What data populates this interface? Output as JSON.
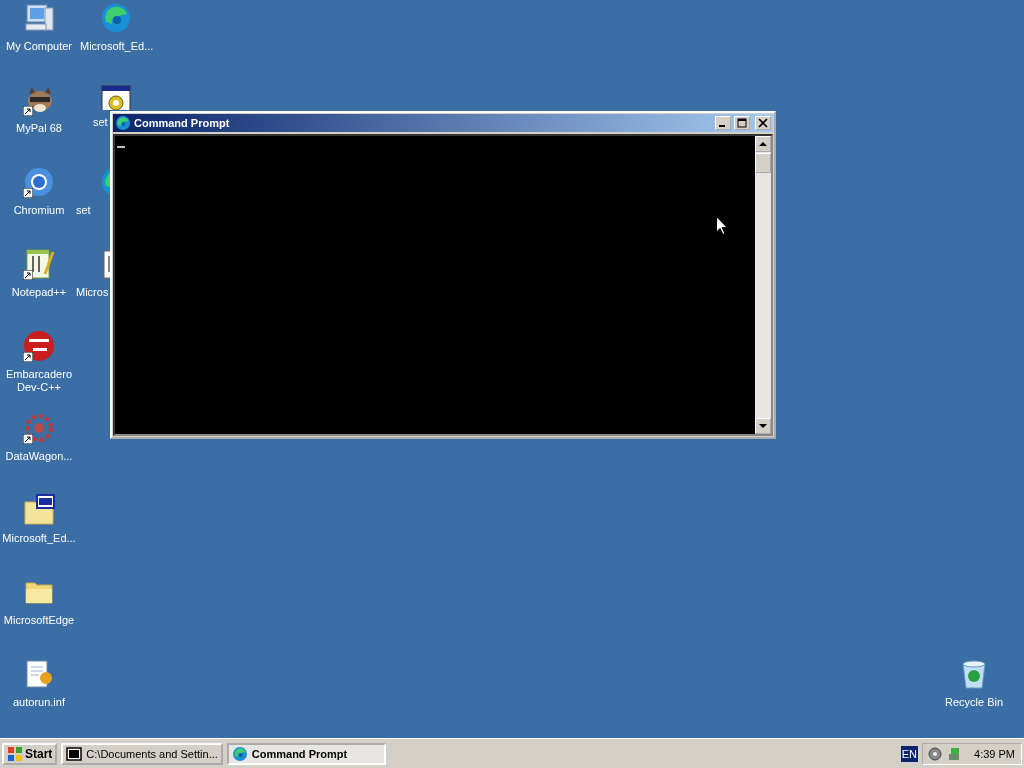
{
  "desktop_icons_column_1": [
    {
      "label": "My Computer",
      "kind": "computer",
      "shortcut": false
    },
    {
      "label": "MyPal 68",
      "kind": "raccoon",
      "shortcut": true
    },
    {
      "label": "Chromium",
      "kind": "chromium",
      "shortcut": true
    },
    {
      "label": "Notepad++",
      "kind": "notepad",
      "shortcut": true
    },
    {
      "label": "Embarcadero Dev-C++",
      "kind": "devcpp",
      "shortcut": true
    },
    {
      "label": "DataWagon...",
      "kind": "datawagon",
      "shortcut": true
    },
    {
      "label": "Microsoft_Ed...",
      "kind": "iso-folder",
      "shortcut": false
    },
    {
      "label": "MicrosoftEdge",
      "kind": "folder",
      "shortcut": false
    },
    {
      "label": "autorun.inf",
      "kind": "inf-file",
      "shortcut": false
    }
  ],
  "desktop_icons_column_2": [
    {
      "label": "Microsoft_Ed...",
      "kind": "edge",
      "shortcut": false
    },
    {
      "label": "set",
      "kind": "setup-window",
      "shortcut": false
    },
    {
      "label": "set",
      "kind": "edge-partial",
      "shortcut": false
    },
    {
      "label": "Micros",
      "kind": "doc-partial",
      "shortcut": false
    }
  ],
  "recycle_bin": {
    "label": "Recycle Bin"
  },
  "window": {
    "title": "Command Prompt"
  },
  "taskbar": {
    "start": "Start",
    "tasks": [
      {
        "label": "C:\\Documents and Settin...",
        "kind": "archive",
        "selected": false
      },
      {
        "label": "Command Prompt",
        "kind": "edge",
        "selected": true
      }
    ],
    "language": "EN",
    "clock": "4:39 PM"
  }
}
